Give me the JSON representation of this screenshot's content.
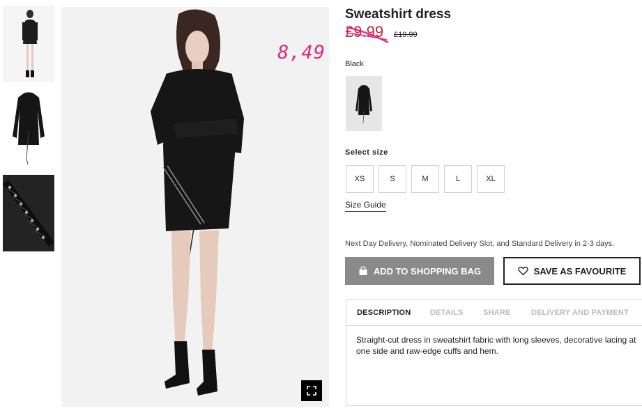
{
  "product": {
    "title": "Sweatshirt dress",
    "price_current": "£9.99",
    "price_old": "£19.99",
    "handwritten_price": "8,49",
    "color_label": "Black",
    "size_label": "Select size",
    "sizes": [
      "XS",
      "S",
      "M",
      "L",
      "XL"
    ],
    "size_guide": "Size Guide",
    "delivery_text": "Next Day Delivery, Nominated Delivery Slot, and Standard Delivery in 2-3 days.",
    "add_to_bag": "ADD TO SHOPPING BAG",
    "save_favourite": "SAVE AS FAVOURITE",
    "tabs": [
      "DESCRIPTION",
      "DETAILS",
      "SHARE",
      "DELIVERY AND PAYMENT"
    ],
    "active_tab": "DESCRIPTION",
    "description": "Straight-cut dress in sweatshirt fabric with long sleeves, decorative lacing at one side and raw-edge cuffs and hem."
  },
  "icons": {
    "bag": "shopping-bag-icon",
    "heart": "heart-icon",
    "expand": "fullscreen-icon"
  },
  "colors": {
    "price_red": "#c5283b",
    "handwritten_pink": "#e4277f",
    "add_button_bg": "#8a8a8a"
  }
}
